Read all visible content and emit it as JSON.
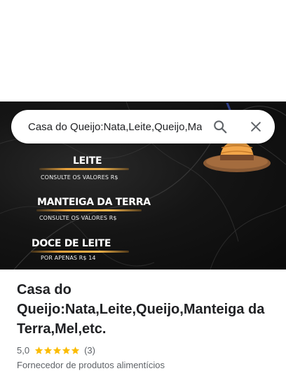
{
  "search": {
    "query": "Casa do Queijo:Nata,Leite,Queijo,Manteiga da Terra,Mel,etc.",
    "search_icon": "search-icon",
    "close_icon": "close-icon"
  },
  "hero": {
    "items": [
      {
        "title": "LEITE",
        "subtitle": "CONSULTE OS VALORES R$"
      },
      {
        "title": "MANTEIGA DA TERRA",
        "subtitle": "CONSULTE OS VALORES R$"
      },
      {
        "title": "DOCE DE LEITE",
        "subtitle": "POR APENAS R$ 14"
      }
    ],
    "accent_color": "#e8a23c",
    "background_color": "#111111"
  },
  "place": {
    "title": "Casa do Queijo:Nata,Leite,Queijo,Manteiga da Terra,Mel,etc.",
    "rating": "5,0",
    "stars": 5,
    "review_count": "(3)",
    "category": "Fornecedor de produtos alimentícios",
    "star_color": "#fbbc04"
  }
}
